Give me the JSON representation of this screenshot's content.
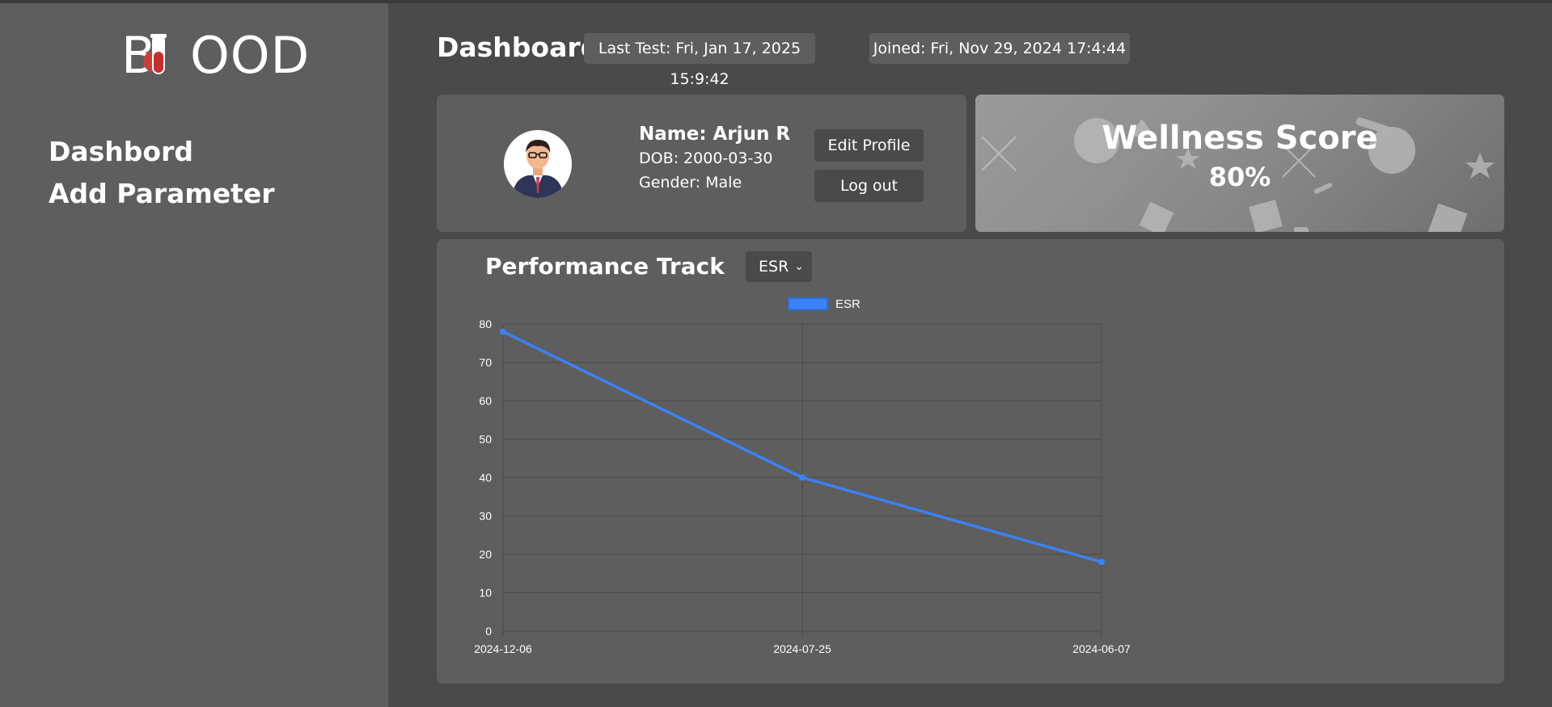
{
  "sidebar": {
    "logo_text": "BLOOD",
    "nav": [
      {
        "label": "Dashbord"
      },
      {
        "label": "Add Parameter"
      }
    ]
  },
  "header": {
    "title": "Dashboard",
    "last_test": "Last Test: Fri, Jan 17, 2025 15:9:42",
    "joined": "Joined: Fri, Nov 29, 2024 17:4:44"
  },
  "profile": {
    "name": "Name: Arjun R",
    "dob": "DOB: 2000-03-30",
    "gender": "Gender: Male",
    "edit_label": "Edit Profile",
    "logout_label": "Log out"
  },
  "wellness": {
    "title": "Wellness Score",
    "value": "80%"
  },
  "performance": {
    "title": "Performance Track",
    "selected": "ESR"
  },
  "colors": {
    "line": "#3b82f6",
    "grid": "#4a4a4a",
    "accent_logo": "#d23a3a"
  },
  "chart_data": {
    "type": "line",
    "categories": [
      "2024-12-06",
      "2024-07-25",
      "2024-06-07"
    ],
    "series": [
      {
        "name": "ESR",
        "values": [
          78,
          40,
          18
        ]
      }
    ],
    "ylim": [
      0,
      80
    ],
    "yticks": [
      0,
      10,
      20,
      30,
      40,
      50,
      60,
      70,
      80
    ],
    "legend": "top-center",
    "grid": true
  }
}
